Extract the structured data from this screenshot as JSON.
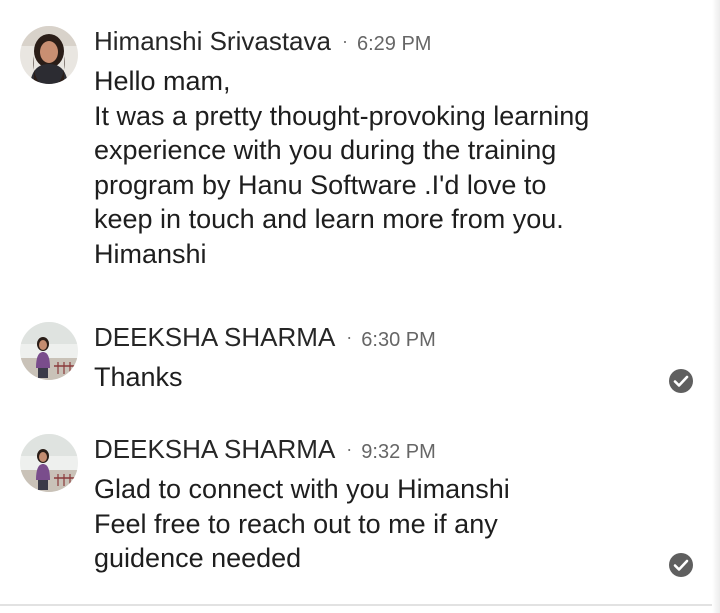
{
  "conversation": {
    "messages": [
      {
        "sender": "Himanshi Srivastava",
        "separator": "·",
        "time": "6:29 PM",
        "lines": [
          "Hello mam,",
          "It was a pretty thought-provoking learning",
          "experience with you during the training",
          "program by Hanu Software .I'd love to",
          "keep in touch and learn more from you.",
          "Himanshi"
        ],
        "read": false
      },
      {
        "sender": "DEEKSHA SHARMA",
        "separator": "·",
        "time": "6:30 PM",
        "lines": [
          "Thanks"
        ],
        "read": true
      },
      {
        "sender": "DEEKSHA SHARMA",
        "separator": "·",
        "time": "9:32 PM",
        "lines": [
          "Glad to connect with you Himanshi",
          "Feel free to reach out to me if any",
          "guidence needed"
        ],
        "read": true
      }
    ]
  },
  "icons": {
    "read_receipt": "check-circle-icon",
    "read_receipt_color": "#5f5f5f"
  }
}
